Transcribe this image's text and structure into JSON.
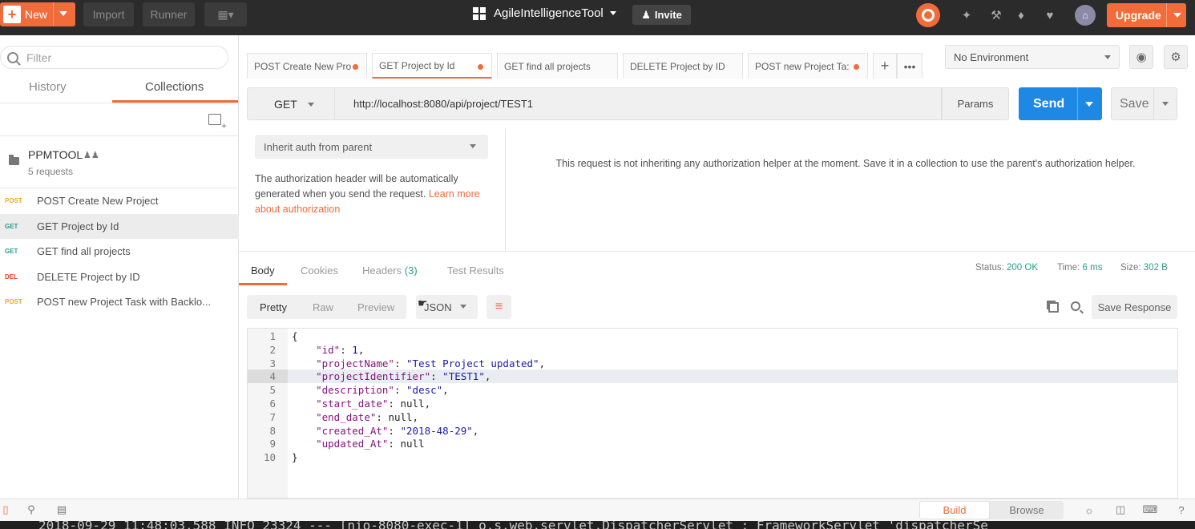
{
  "topbar": {
    "new_label": "New",
    "import_label": "Import",
    "runner_label": "Runner",
    "workspace": "AgileIntelligenceTool",
    "invite_label": "Invite",
    "upgrade_label": "Upgrade",
    "avatar_initial": "⌂"
  },
  "sidebar": {
    "filter_placeholder": "Filter",
    "tab_history": "History",
    "tab_collections": "Collections",
    "collection": {
      "name": "PPMTOOL",
      "count": "5 requests"
    },
    "requests": [
      {
        "method": "POST",
        "name": "POST Create New Project",
        "color": "#f5a623"
      },
      {
        "method": "GET",
        "name": "GET Project by Id",
        "color": "#2a9d8f"
      },
      {
        "method": "GET",
        "name": "GET find all projects",
        "color": "#2a9d8f"
      },
      {
        "method": "DEL",
        "name": "DELETE Project by ID",
        "color": "#e53935"
      },
      {
        "method": "POST",
        "name": "POST new Project Task with Backlo...",
        "color": "#f5a623"
      }
    ]
  },
  "tabs": [
    {
      "label": "POST Create New Pro"
    },
    {
      "label": "GET Project by Id"
    },
    {
      "label": "GET find all projects"
    },
    {
      "label": "DELETE Project by ID"
    },
    {
      "label": "POST new Project Ta:"
    }
  ],
  "environment": "No Environment",
  "request": {
    "method": "GET",
    "url": "http://localhost:8080/api/project/TEST1",
    "params_label": "Params",
    "send_label": "Send",
    "save_label": "Save"
  },
  "auth": {
    "type": "Inherit auth from parent",
    "desc": "The authorization header will be automatically generated when you send the request. ",
    "link": "Learn more about authorization",
    "message": "This request is not inheriting any authorization helper at the moment. Save it in a collection to use the parent's authorization helper."
  },
  "response": {
    "tabs": {
      "body": "Body",
      "cookies": "Cookies",
      "headers": "Headers",
      "headers_count": "(3)",
      "tests": "Test Results"
    },
    "status_label": "Status:",
    "status": "200 OK",
    "time_label": "Time:",
    "time": "6 ms",
    "size_label": "Size:",
    "size": "302 B",
    "formats": {
      "pretty": "Pretty",
      "raw": "Raw",
      "preview": "Preview"
    },
    "format_select": "JSON",
    "save_response": "Save Response"
  },
  "code_lines": [
    {
      "n": "1",
      "text": "{"
    },
    {
      "n": "2",
      "text": "    \"id\": 1,"
    },
    {
      "n": "3",
      "text": "    \"projectName\": \"Test Project updated\","
    },
    {
      "n": "4",
      "text": "    \"projectIdentifier\": \"TEST1\","
    },
    {
      "n": "5",
      "text": "    \"description\": \"desc\","
    },
    {
      "n": "6",
      "text": "    \"start_date\": null,"
    },
    {
      "n": "7",
      "text": "    \"end_date\": null,"
    },
    {
      "n": "8",
      "text": "    \"created_At\": \"2018-48-29\","
    },
    {
      "n": "9",
      "text": "    \"updated_At\": null"
    },
    {
      "n": "10",
      "text": "}"
    }
  ],
  "bottombar": {
    "build": "Build",
    "browse": "Browse"
  },
  "console_text": "2018-09-29 11:48:03.588  INFO 23324 --- [nio-8080-exec-1] o.s.web.servlet.DispatcherServlet        : FrameworkServlet 'dispatcherSe"
}
